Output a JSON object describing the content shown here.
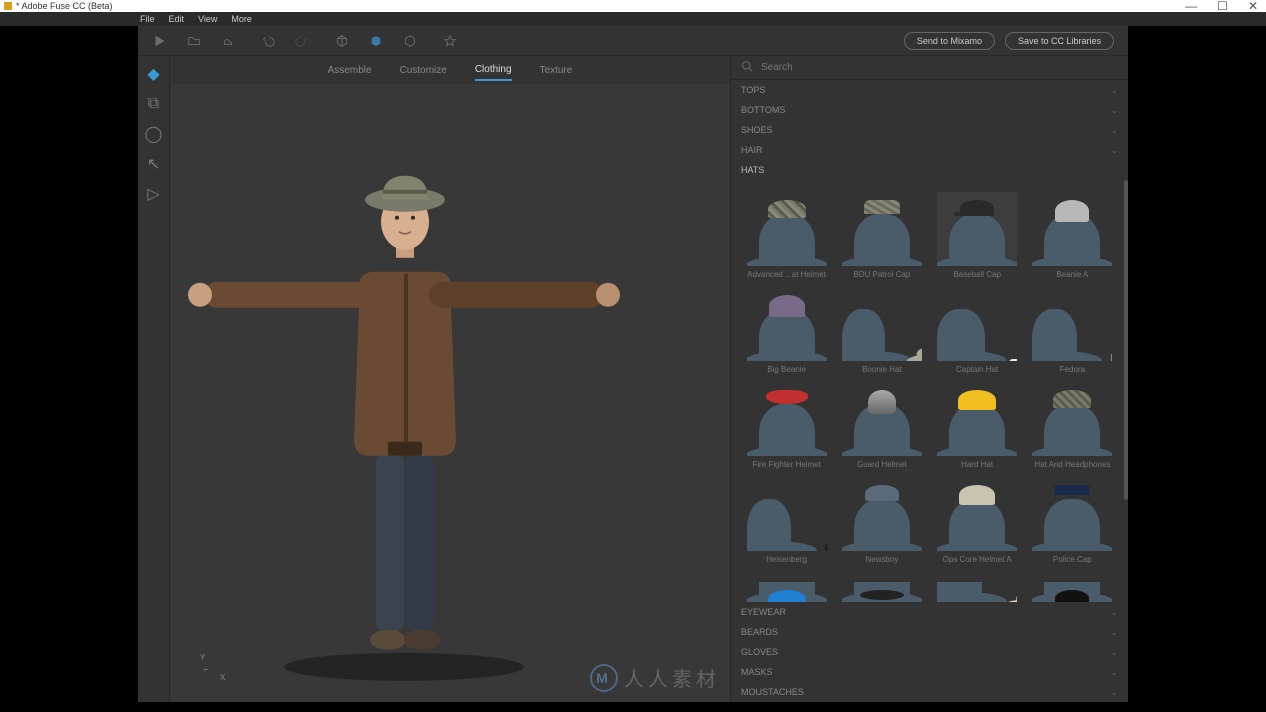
{
  "titlebar": {
    "title": "* Adobe Fuse CC (Beta)",
    "minimize": "—",
    "maximize": "☐",
    "close": "✕"
  },
  "menubar": [
    "File",
    "Edit",
    "View",
    "More"
  ],
  "toolbar": {
    "send_mixamo": "Send to Mixamo",
    "save_cc": "Save to CC Libraries"
  },
  "tabs": [
    {
      "label": "Assemble",
      "active": false
    },
    {
      "label": "Customize",
      "active": false
    },
    {
      "label": "Clothing",
      "active": true
    },
    {
      "label": "Texture",
      "active": false
    }
  ],
  "search": {
    "placeholder": "Search"
  },
  "categories_top": [
    {
      "label": "TOPS"
    },
    {
      "label": "BOTTOMS"
    },
    {
      "label": "SHOES"
    },
    {
      "label": "HAIR"
    }
  ],
  "hats_label": "HATS",
  "hats": [
    {
      "label": "Advanced ...at Helmet",
      "style": "hat-camo"
    },
    {
      "label": "BDU Patrol Cap",
      "style": "hat-cap-camo"
    },
    {
      "label": "Baseball Cap",
      "style": "hat-baseball"
    },
    {
      "label": "Beanie A",
      "style": "hat-beanie-gray"
    },
    {
      "label": "Big Beanie",
      "style": "hat-big-beanie"
    },
    {
      "label": "Boonie Hat",
      "style": "hat-boonie"
    },
    {
      "label": "Captain Hat",
      "style": "hat-captain"
    },
    {
      "label": "Fedora",
      "style": "hat-fedora"
    },
    {
      "label": "Fire Fighter Helmet",
      "style": "hat-fire"
    },
    {
      "label": "Guard Helmet",
      "style": "hat-guard"
    },
    {
      "label": "Hard Hat",
      "style": "hat-hard"
    },
    {
      "label": "Hat And Headphones",
      "style": "hat-headphones"
    },
    {
      "label": "Heisenberg",
      "style": "hat-heisenberg"
    },
    {
      "label": "Newsboy",
      "style": "hat-newsboy"
    },
    {
      "label": "Ops Core Helmet A",
      "style": "hat-ops"
    },
    {
      "label": "Police Cap",
      "style": "hat-police"
    }
  ],
  "hats_partial": [
    {
      "style": "hat-blue-partial"
    },
    {
      "style": "hat-dark-partial"
    },
    {
      "style": "hat-straw-partial"
    },
    {
      "style": "hat-black-partial"
    }
  ],
  "categories_bottom": [
    {
      "label": "EYEWEAR"
    },
    {
      "label": "BEARDS"
    },
    {
      "label": "GLOVES"
    },
    {
      "label": "MASKS"
    },
    {
      "label": "MOUSTACHES"
    }
  ],
  "axis": {
    "y": "Y",
    "x": "X"
  },
  "watermark": "人人素材"
}
